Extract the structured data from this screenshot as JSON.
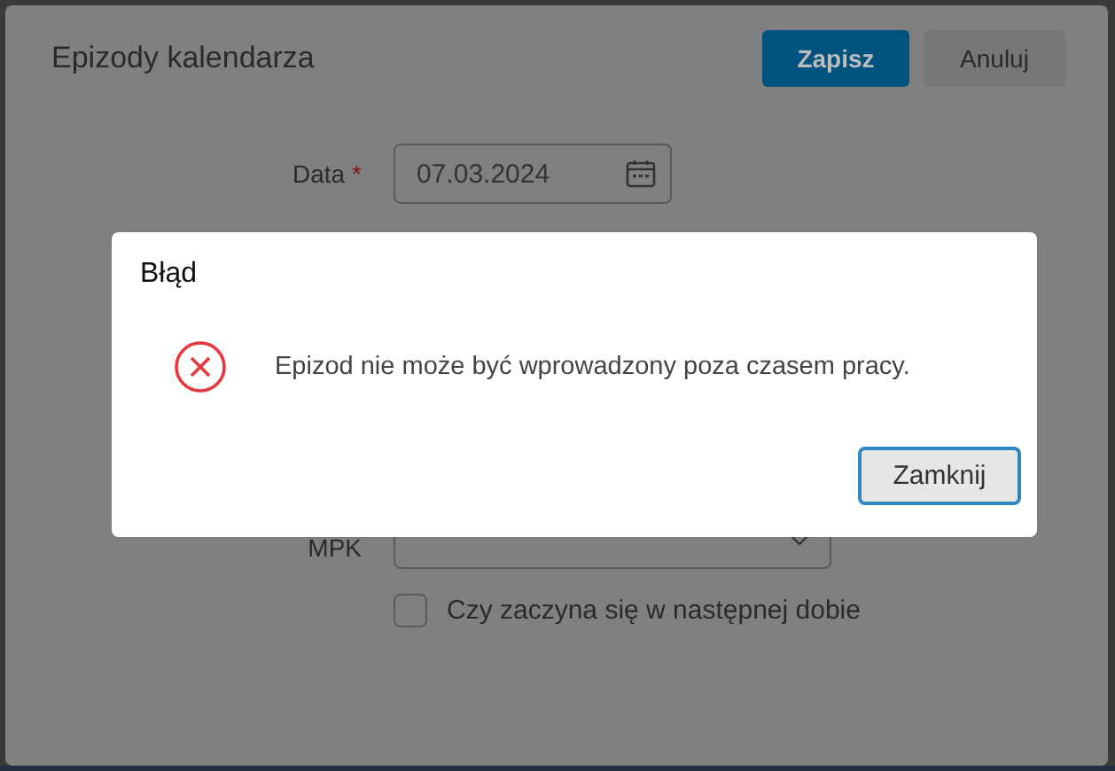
{
  "dialog": {
    "title": "Epizody kalendarza",
    "buttons": [
      {
        "label": "Zapisz",
        "kind": "primary"
      },
      {
        "label": "Anuluj",
        "kind": "secondary"
      }
    ]
  },
  "form": {
    "date": {
      "label": "Data",
      "required": true,
      "required_mark": "*",
      "value": "07.03.2024"
    },
    "mpk": {
      "label": "MPK"
    },
    "next_day": {
      "label": "Czy zaczyna się w następnej dobie",
      "checked": false
    }
  },
  "alert": {
    "title": "Błąd",
    "message": "Epizod nie może być wprowadzony poza czasem pracy.",
    "kind": "error",
    "button": "Zamknij"
  }
}
